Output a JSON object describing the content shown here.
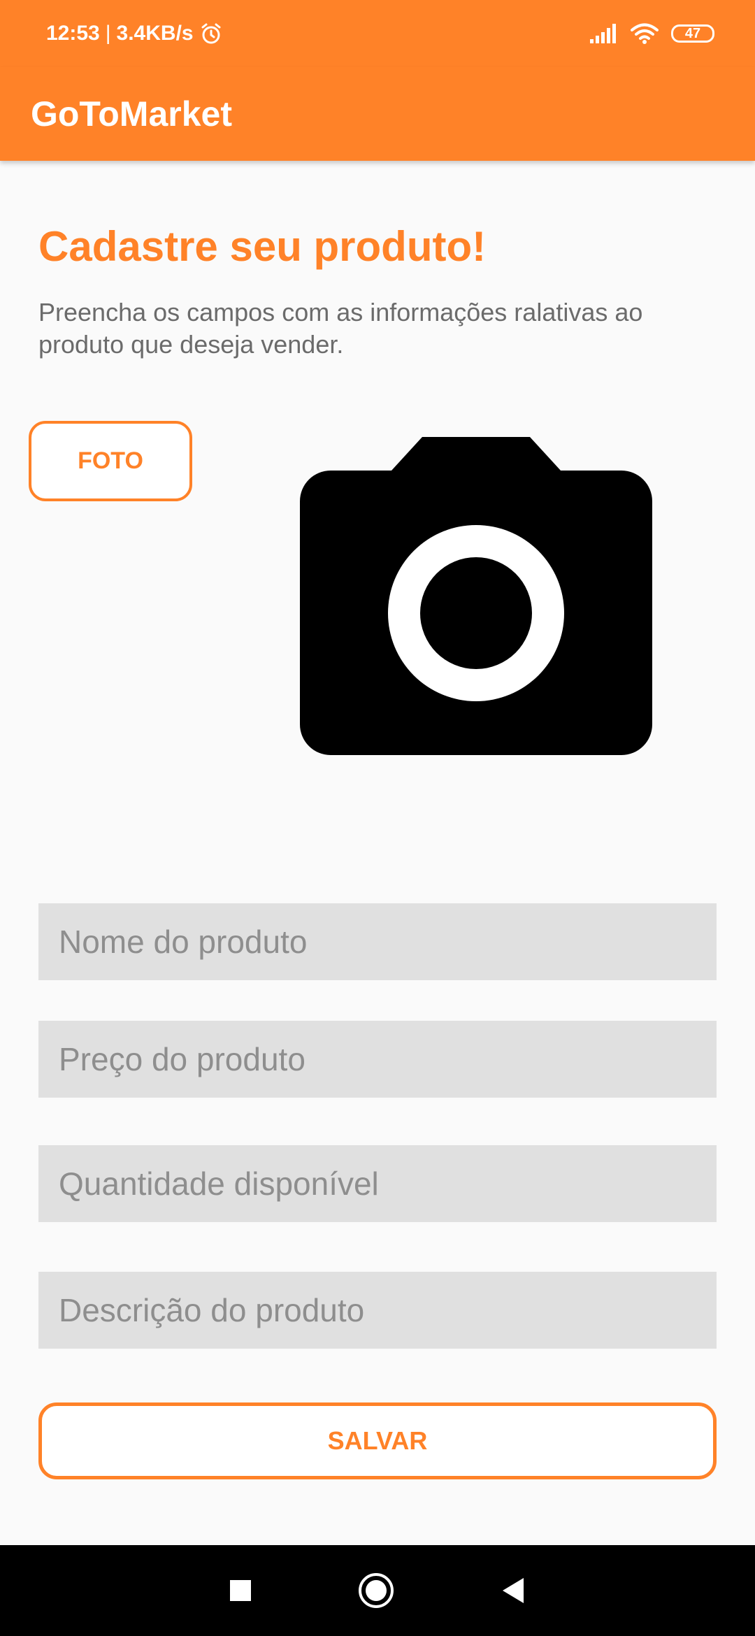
{
  "status_bar": {
    "time": "12:53",
    "separator": "|",
    "network_speed": "3.4KB/s",
    "battery_level": "47",
    "icons": [
      "alarm-icon",
      "signal-icon",
      "wifi-icon",
      "battery-icon"
    ]
  },
  "app_bar": {
    "title": "GoToMarket"
  },
  "main": {
    "heading": "Cadastre seu produto!",
    "subtitle": "Preencha os campos com as informações ralativas ao produto que deseja vender.",
    "photo_button": "FOTO",
    "photo_placeholder_icon": "camera-icon",
    "fields": {
      "name": {
        "placeholder": "Nome do produto",
        "value": ""
      },
      "price": {
        "placeholder": "Preço do produto",
        "value": ""
      },
      "quantity": {
        "placeholder": "Quantidade disponível",
        "value": ""
      },
      "description": {
        "placeholder": "Descrição do produto",
        "value": ""
      }
    },
    "save_button": "SALVAR"
  },
  "nav_bar": {
    "icons": [
      "recents-icon",
      "home-icon",
      "back-icon"
    ]
  },
  "colors": {
    "accent": "#ff8228",
    "background": "#fafafa",
    "field_background": "#e0e0e0",
    "subtitle_text": "#6b6b6b",
    "placeholder_text": "#8e8e8e"
  }
}
